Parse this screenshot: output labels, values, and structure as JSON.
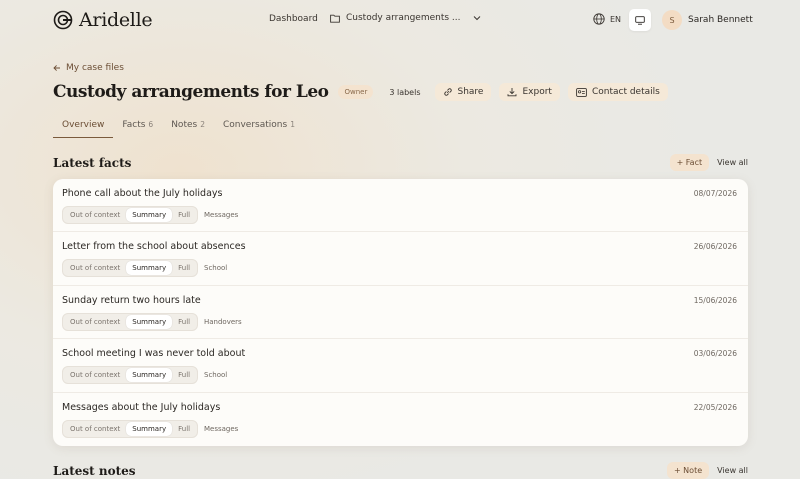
{
  "brand": {
    "name": "Aridelle"
  },
  "nav": {
    "dashboard": "Dashboard",
    "case_menu": "Custody arrangements ..."
  },
  "header": {
    "language": "EN",
    "user_initial": "S",
    "user_name": "Sarah Bennett"
  },
  "page": {
    "back_link": "My case files",
    "title": "Custody arrangements for Leo",
    "role_badge": "Owner",
    "labels": "3 labels",
    "share": "Share",
    "export": "Export",
    "contact": "Contact details"
  },
  "tabs": [
    {
      "label": "Overview",
      "count": ""
    },
    {
      "label": "Facts",
      "count": "6"
    },
    {
      "label": "Notes",
      "count": "2"
    },
    {
      "label": "Conversations",
      "count": "1"
    }
  ],
  "facts_section": {
    "title": "Latest facts",
    "add_label": "+ Fact",
    "view_all": "View all"
  },
  "view_modes": {
    "out_of_context": "Out of context",
    "summary": "Summary",
    "full": "Full"
  },
  "facts": [
    {
      "title": "Phone call about the July holidays",
      "date": "08/07/2026",
      "tag": "Messages"
    },
    {
      "title": "Letter from the school about absences",
      "date": "26/06/2026",
      "tag": "School"
    },
    {
      "title": "Sunday return two hours late",
      "date": "15/06/2026",
      "tag": "Handovers"
    },
    {
      "title": "School meeting I was never told about",
      "date": "03/06/2026",
      "tag": "School"
    },
    {
      "title": "Messages about the July holidays",
      "date": "22/05/2026",
      "tag": "Messages"
    }
  ],
  "notes_section": {
    "title": "Latest notes",
    "add_label": "+ Note",
    "view_all": "View all"
  },
  "colors": {
    "accent": "#7a5a3c",
    "accent_soft": "#f4e3cf",
    "card": "#fdfcf9"
  }
}
